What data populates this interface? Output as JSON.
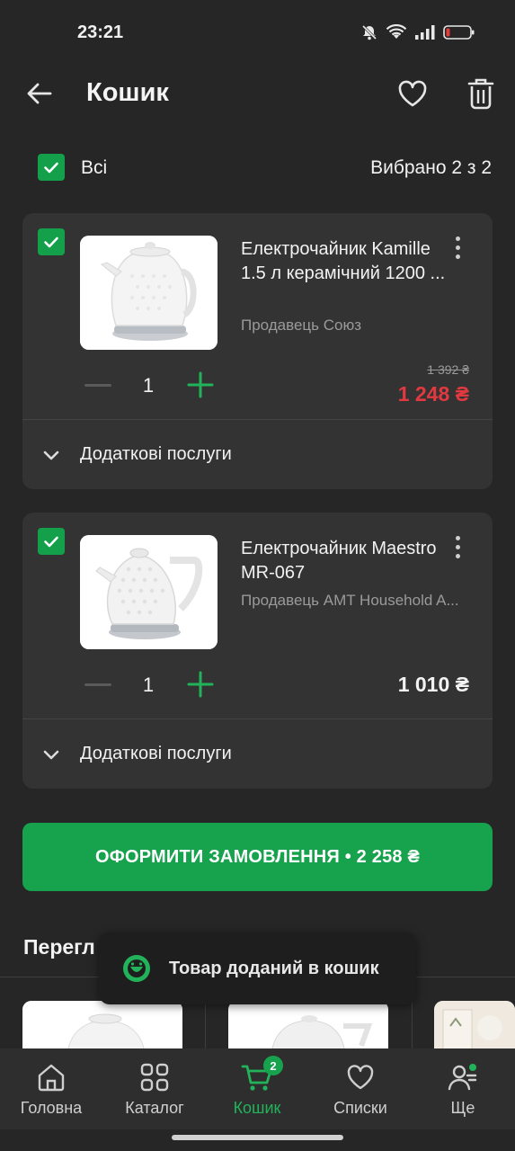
{
  "status": {
    "time": "23:21"
  },
  "header": {
    "title": "Кошик"
  },
  "select_all": {
    "label": "Всі",
    "selected_text": "Вибрано 2 з 2"
  },
  "cart_items": [
    {
      "name": "Електрочайник Kamille 1.5 л керамічний 1200 ...",
      "seller": "Продавець Союз",
      "quantity": "1",
      "old_price": "1 392 ₴",
      "price": "1 248 ₴",
      "price_color": "#e2383f",
      "services_label": "Додаткові послуги"
    },
    {
      "name": "Електрочайник Maestro MR-067",
      "seller": "Продавець AMT Household A...",
      "quantity": "1",
      "old_price": "",
      "price": "1 010 ₴",
      "price_color": "#f2f2f2",
      "services_label": "Додаткові послуги"
    }
  ],
  "checkout": {
    "label": "ОФОРМИТИ ЗАМОВЛЕННЯ • 2 258 ₴"
  },
  "viewed": {
    "title": "Перегл"
  },
  "toast": {
    "text": "Товар доданий в кошик"
  },
  "nav": {
    "items": [
      {
        "label": "Головна",
        "icon": "home-icon"
      },
      {
        "label": "Каталог",
        "icon": "catalog-icon"
      },
      {
        "label": "Кошик",
        "icon": "cart-icon",
        "badge": "2"
      },
      {
        "label": "Списки",
        "icon": "heart-icon"
      },
      {
        "label": "Ще",
        "icon": "profile-icon"
      }
    ]
  },
  "colors": {
    "accent": "#17a24d",
    "background": "#262626",
    "card": "#333333",
    "sale_price": "#e2383f"
  }
}
